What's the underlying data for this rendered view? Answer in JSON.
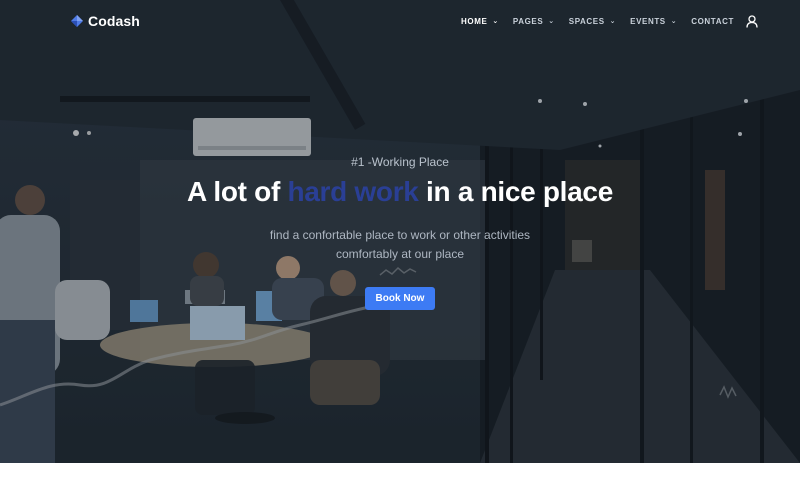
{
  "brand": {
    "name": "Codash",
    "logo_icon": "diamond-logo-icon"
  },
  "colors": {
    "accent": "#3d7bf4",
    "headline_accent": "#2a3f95",
    "text": "#ffffff",
    "nav_text": "#c9d1da"
  },
  "nav": {
    "items": [
      {
        "label": "HOME",
        "dropdown": true,
        "active": true
      },
      {
        "label": "PAGES",
        "dropdown": true,
        "active": false
      },
      {
        "label": "SPACES",
        "dropdown": true,
        "active": false
      },
      {
        "label": "EVENTS",
        "dropdown": true,
        "active": false
      },
      {
        "label": "CONTACT",
        "dropdown": false,
        "active": false
      }
    ],
    "chevron_icon": "chevron-down-icon",
    "account_icon": "user-icon"
  },
  "hero": {
    "eyebrow": "#1 -Working Place",
    "headline": {
      "before": "A lot of ",
      "accent": "hard work",
      "after": " in a nice place"
    },
    "subtext_line1": "find a confortable place to work or other activities",
    "subtext_line2": "comfortably at our place",
    "cta_label": "Book Now",
    "background": "office-meeting-room-photo"
  }
}
